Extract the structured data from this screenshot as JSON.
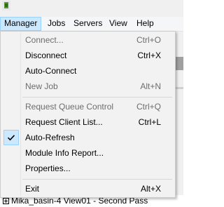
{
  "menubar": {
    "items": [
      {
        "label": "Manager"
      },
      {
        "label": "Jobs"
      },
      {
        "label": "Servers"
      },
      {
        "label": "View"
      },
      {
        "label": "Help"
      }
    ]
  },
  "manager_menu": {
    "items": [
      {
        "label": "Connect...",
        "shortcut": "Ctrl+O",
        "enabled": false
      },
      {
        "label": "Disconnect",
        "shortcut": "Ctrl+X",
        "enabled": true
      },
      {
        "label": "Auto-Connect",
        "shortcut": "",
        "enabled": true
      },
      {
        "label": "New Job",
        "shortcut": "Alt+N",
        "enabled": false
      },
      {
        "label": "Request Queue Control",
        "shortcut": "Ctrl+Q",
        "enabled": false
      },
      {
        "label": "Request Client List...",
        "shortcut": "Ctrl+L",
        "enabled": true
      },
      {
        "label": "Auto-Refresh",
        "shortcut": "",
        "enabled": true,
        "checked": true
      },
      {
        "label": "Module Info Report...",
        "shortcut": "",
        "enabled": true
      },
      {
        "label": "Properties...",
        "shortcut": "",
        "enabled": true
      },
      {
        "label": "Exit",
        "shortcut": "Alt+X",
        "enabled": true
      }
    ]
  },
  "background": {
    "tree_item_label": "Mika_basin-4 View01 - Second Pass"
  },
  "colors": {
    "menu_bg": "#f2f2f2",
    "highlight_bg": "#cce8ff",
    "highlight_border": "#99d1ff",
    "disabled_text": "#6d6d6d"
  }
}
